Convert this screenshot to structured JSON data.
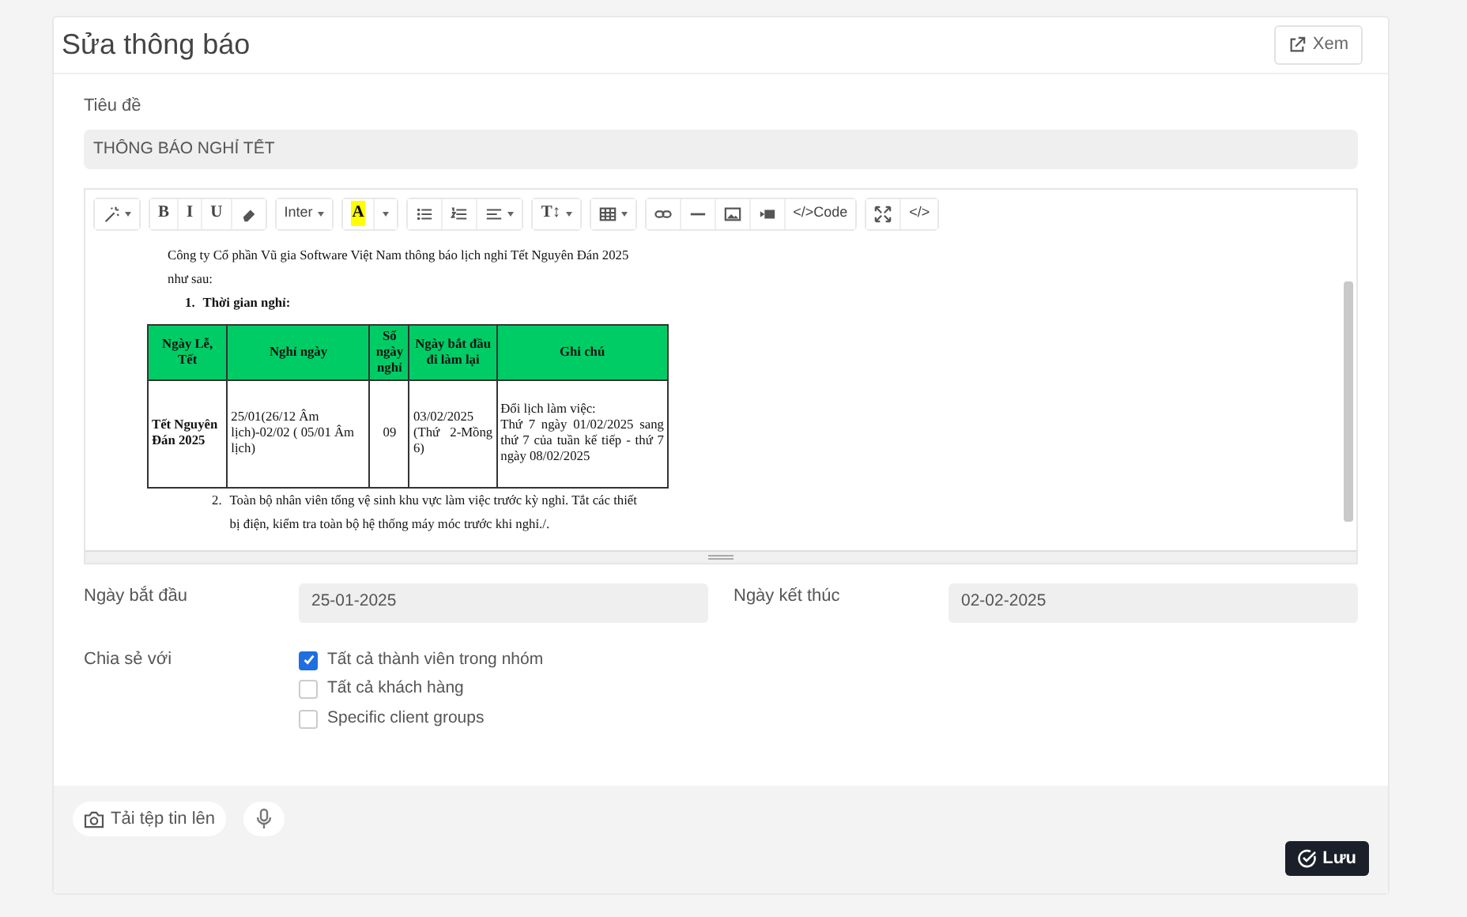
{
  "header": {
    "title": "Sửa thông báo",
    "view_button": "Xem"
  },
  "title_field": {
    "label": "Tiêu đề",
    "value": "THÔNG BÁO NGHỈ TẾT"
  },
  "toolbar": [
    [
      {
        "kind": "icon",
        "caret": true
      }
    ],
    [
      {
        "kind": "text",
        "label": "B",
        "caret": false
      },
      {
        "kind": "text",
        "label": "I",
        "caret": false
      },
      {
        "kind": "text",
        "label": "U",
        "caret": false
      },
      {
        "kind": "icon",
        "caret": false
      }
    ],
    [
      {
        "kind": "text",
        "label": "Inter",
        "caret": true
      }
    ],
    [
      {
        "kind": "color",
        "label": "A",
        "caret": false
      },
      {
        "kind": "caret",
        "caret": true
      }
    ],
    [
      {
        "kind": "icon",
        "caret": false
      },
      {
        "kind": "icon",
        "caret": false
      },
      {
        "kind": "icon",
        "caret": true
      }
    ],
    [
      {
        "kind": "text",
        "label": "T↕",
        "caret": true
      }
    ],
    [
      {
        "kind": "icon",
        "caret": true
      }
    ],
    [
      {
        "kind": "icon",
        "caret": false
      },
      {
        "kind": "icon",
        "caret": false
      },
      {
        "kind": "icon",
        "caret": false
      },
      {
        "kind": "icon",
        "caret": false
      },
      {
        "kind": "text",
        "label": "</>Code",
        "caret": false
      }
    ],
    [
      {
        "kind": "icon",
        "caret": false
      },
      {
        "kind": "text",
        "label": "</>",
        "caret": false
      }
    ]
  ],
  "document": {
    "intro": "Công ty Cổ phần Vũ gia Software Việt Nam thông báo lịch nghỉ Tết Nguyên Đán 2025 như sau:",
    "items": [
      {
        "number": "1.",
        "text": "Thời gian nghỉ:",
        "bold": true
      },
      {
        "number": "2.",
        "text": "Toàn bộ nhân viên tổng vệ sinh khu vực làm việc trước kỳ nghỉ. Tắt các thiết bị điện, kiểm tra toàn bộ hệ thống máy móc trước khi nghỉ./.",
        "bold": false
      }
    ],
    "table": {
      "columns": [
        "Ngày Lễ, Tết",
        "Nghỉ ngày",
        "Số ngày nghỉ",
        "Ngày bắt đầu đi làm lại",
        "Ghi chú"
      ],
      "rows": [
        [
          "Tết Nguyên Đán 2025",
          "25/01(26/12 Âm lịch)-02/02 ( 05/01 Âm lịch)",
          "09",
          "03/02/2025 (Thứ 2-Mồng 6)",
          "Đổi lịch làm việc:\nThứ 7 ngày 01/02/2025 sang thứ 7 của tuần kế tiếp - thứ 7 ngày 08/02/2025"
        ]
      ]
    }
  },
  "dates": [
    {
      "label": "Ngày bắt đầu",
      "value": "25-01-2025"
    },
    {
      "label": "Ngày kết thúc",
      "value": "02-02-2025"
    }
  ],
  "share": {
    "label": "Chia sẻ với",
    "options": [
      {
        "label": "Tất cả thành viên trong nhóm",
        "checked": true
      },
      {
        "label": "Tất cả khách hàng",
        "checked": false
      },
      {
        "label": "Specific client groups",
        "checked": false
      }
    ]
  },
  "footer": {
    "upload_button": "Tải tệp tin lên",
    "save_button": "Lưu"
  }
}
